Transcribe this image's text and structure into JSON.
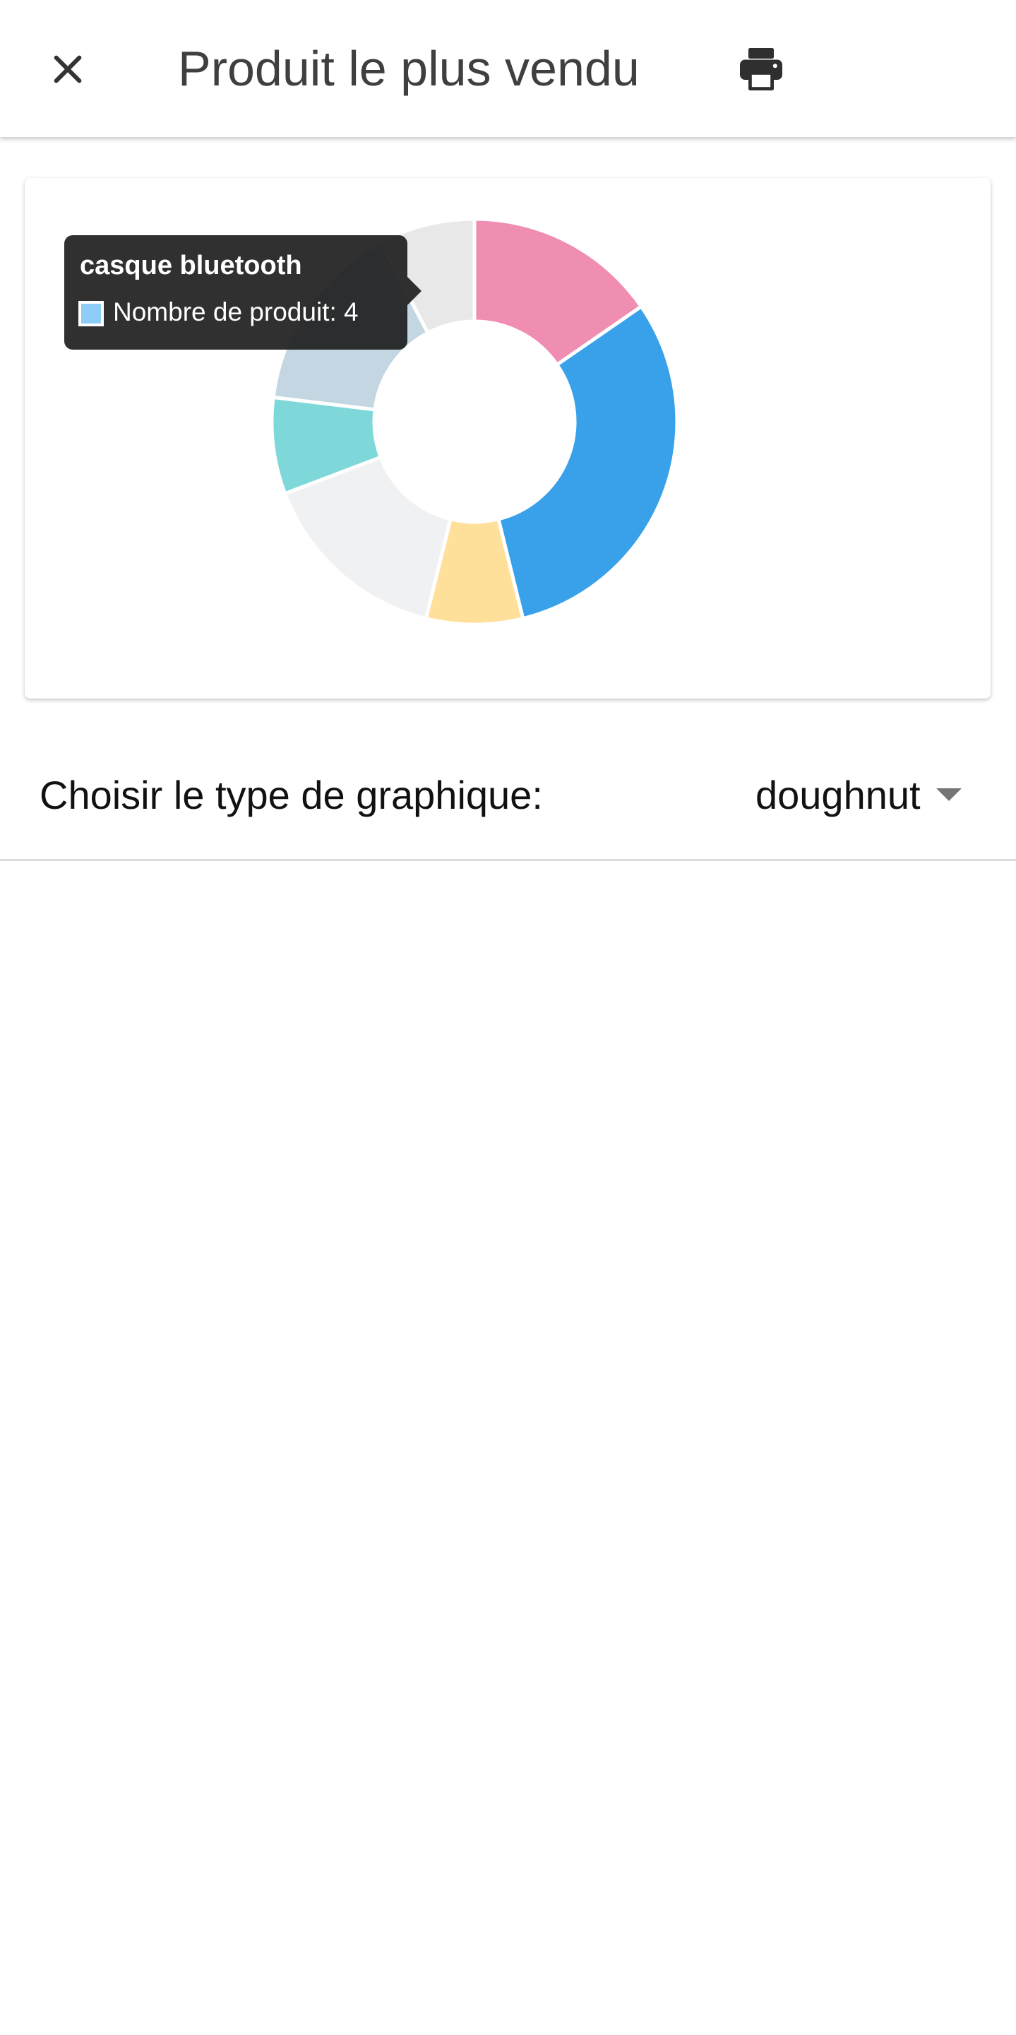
{
  "header": {
    "close_icon": "close-icon",
    "title": "Produit le plus vendu",
    "print_icon": "print-icon"
  },
  "chart_data": {
    "type": "doughnut",
    "series": [
      {
        "values": [
          1.5,
          3,
          0.75,
          1.5,
          0.75,
          1.5,
          0.75
        ],
        "colors": [
          "#f08db2",
          "#38a1ea",
          "#ffe09a",
          "#f0f1f2",
          "#7ed8da",
          "#c3d6e2",
          "#e8e8e8"
        ]
      }
    ]
  },
  "tooltip": {
    "title": "casque bluetooth",
    "line": "Nombre de produit: 4",
    "swatch_color": "#8ecdf5"
  },
  "chart_type_select": {
    "label": "Choisir le type de graphique:",
    "value": "doughnut"
  }
}
